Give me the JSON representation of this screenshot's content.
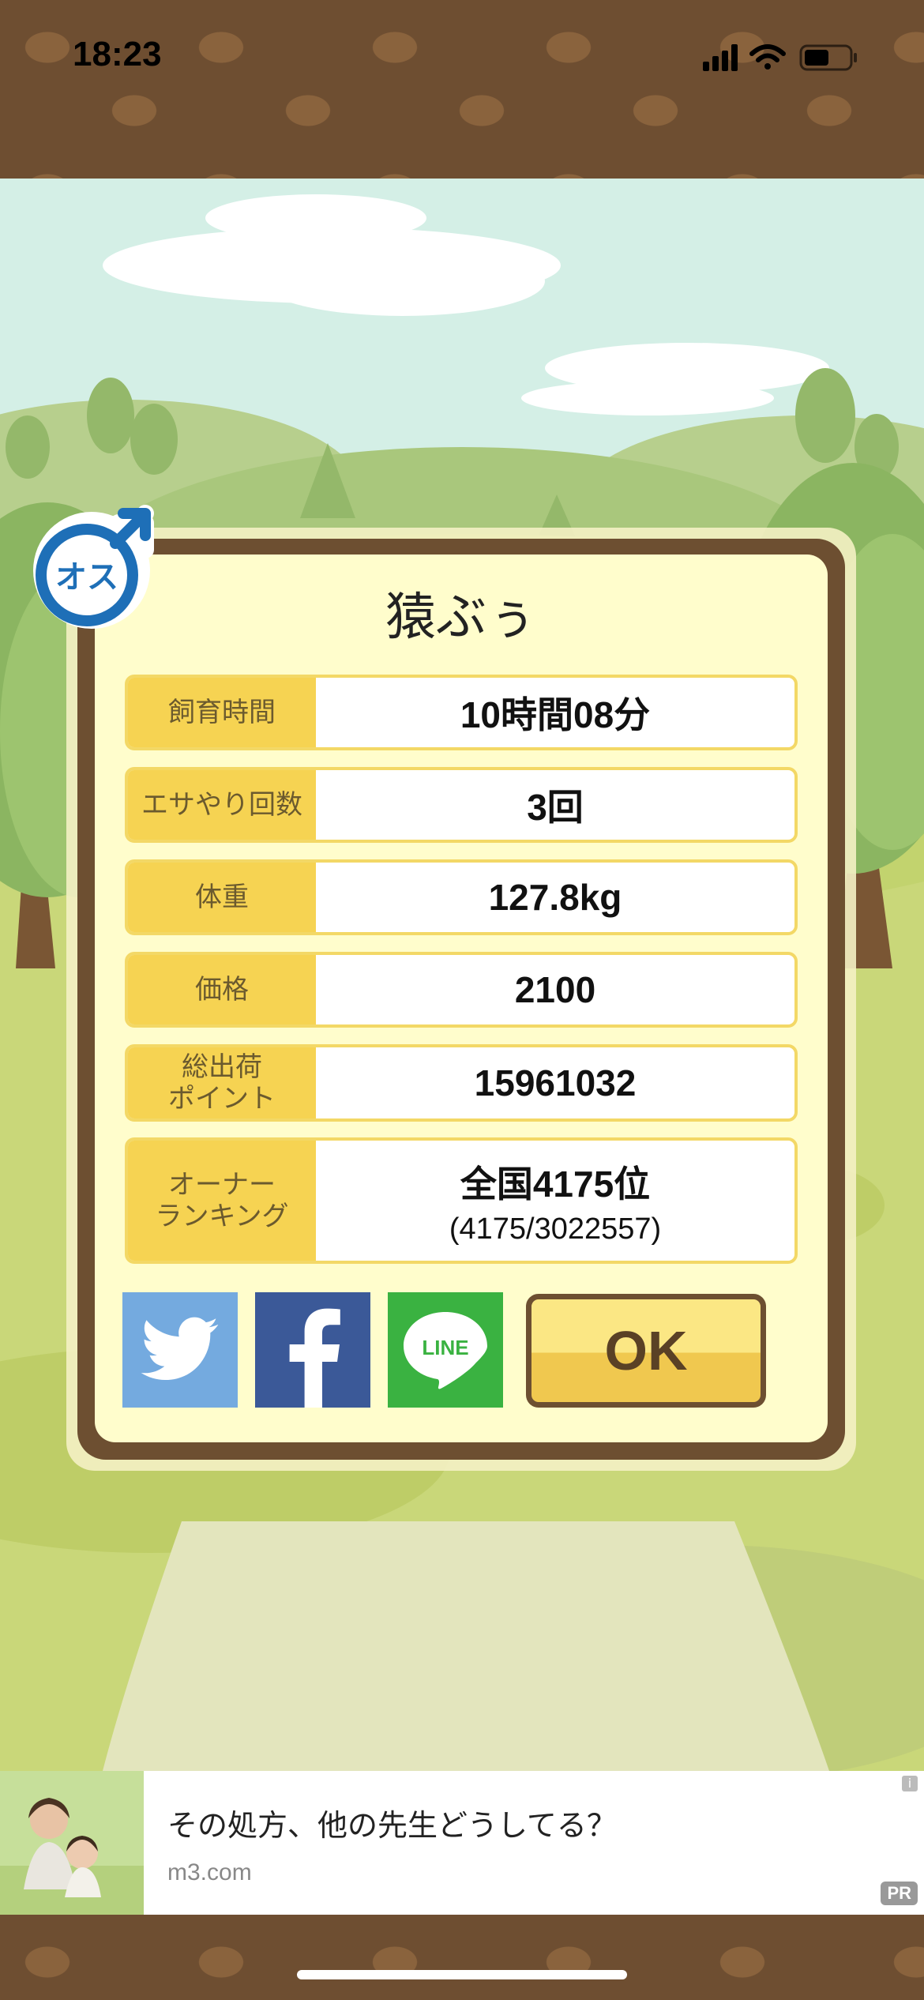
{
  "status_bar": {
    "time": "18:23"
  },
  "dialog": {
    "title": "猿ぶぅ",
    "rows": [
      {
        "label": "飼育時間",
        "value": "10時間08分"
      },
      {
        "label": "エサやり回数",
        "value": "3回"
      },
      {
        "label": "体重",
        "value": "127.8kg"
      },
      {
        "label": "価格",
        "value": "2100"
      },
      {
        "label": "総出荷\nポイント",
        "value": "15961032"
      },
      {
        "label": "オーナー\nランキング",
        "value": "全国4175位",
        "sub": "(4175/3022557)"
      }
    ],
    "gender_badge": "オス",
    "share": {
      "line_label": "LINE"
    },
    "ok_label": "OK"
  },
  "ad": {
    "title": "その処方、他の先生どうしてる？",
    "domain": "m3.com",
    "pr_label": "PR",
    "info_label": "i"
  },
  "colors": {
    "twitter": "#74aadf",
    "facebook": "#3b5998",
    "line": "#3ab241",
    "label_bg": "#f6d352",
    "frame": "#6d4f31"
  }
}
